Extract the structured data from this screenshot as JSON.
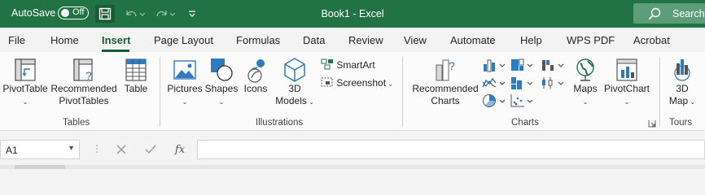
{
  "titlebar": {
    "autosave_label": "AutoSave",
    "autosave_state": "Off",
    "title": "Book1  -  Excel",
    "search_label": "Search"
  },
  "tabs": [
    "File",
    "Home",
    "Insert",
    "Page Layout",
    "Formulas",
    "Data",
    "Review",
    "View",
    "Automate",
    "Help",
    "WPS PDF",
    "Acrobat"
  ],
  "active_tab": "Insert",
  "ribbon": {
    "pivottable": "PivotTable",
    "recommended_pivot_1": "Recommended",
    "recommended_pivot_2": "PivotTables",
    "table": "Table",
    "tables_group": "Tables",
    "pictures": "Pictures",
    "shapes": "Shapes",
    "icons": "Icons",
    "models_1": "3D",
    "models_2": "Models",
    "smartart": "SmartArt",
    "screenshot": "Screenshot",
    "illustrations_group": "Illustrations",
    "rec_charts_1": "Recommended",
    "rec_charts_2": "Charts",
    "charts_group": "Charts",
    "maps": "Maps",
    "pivotchart": "PivotChart",
    "map3d_1": "3D",
    "map3d_2": "Map",
    "tours_group": "Tours"
  },
  "formula_bar": {
    "name_box": "A1",
    "fx": "fx",
    "formula": ""
  },
  "colors": {
    "excel_green": "#217346",
    "active_tab": "#185c37",
    "icon_blue": "#2f7bbf"
  }
}
